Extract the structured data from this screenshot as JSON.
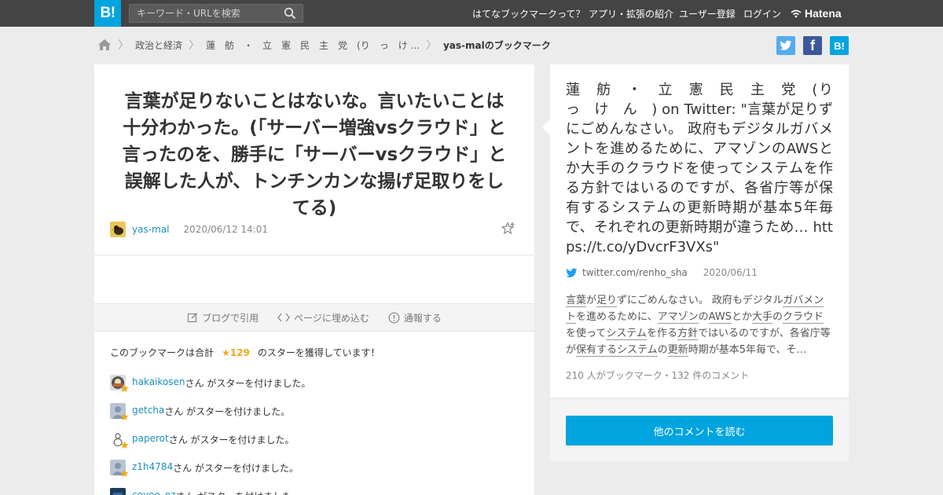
{
  "header": {
    "logo": "B!",
    "search_placeholder": "キーワード・URLを検索",
    "nav": [
      "はてなブックマークって？",
      "アプリ・拡張の紹介",
      "ユーザー登録",
      "ログイン"
    ],
    "hatena": "Hatena"
  },
  "breadcrumb": {
    "items": [
      "政治と経済",
      "蓮　舫　・　立　憲　民　主　党　(り　っ　け ..."
    ],
    "current": "yas-malのブックマーク"
  },
  "share": {
    "twitter": "twitter",
    "facebook": "f",
    "hatena": "B!"
  },
  "bookmark": {
    "comment": "言葉が足りないことはないな。言いたいことは十分わかった。(「サーバー増強vsクラウド」と言ったのを、勝手に「サーバーvsクラウド」と誤解した人が、トンチンカンな揚げ足取りをしてる)",
    "user": "yas-mal",
    "date": "2020/06/12 14:01"
  },
  "actions": {
    "blog": "ブログで引用",
    "embed": "ページに埋め込む",
    "report": "通報する"
  },
  "stars": {
    "prefix": "このブックマークは合計",
    "count": "★129",
    "suffix": "のスターを獲得しています！",
    "starer_suffix": "さん がスターを付けました。",
    "starers": [
      "hakaikosen",
      "getcha",
      "paperot",
      "z1h4784",
      "coyoo_oz"
    ]
  },
  "entry": {
    "title": "蓮　舫　・　立　憲　民　主　党　(り　っ　け　ん　) on Twitter: \"言葉が足りずにごめんなさい。 政府もデジタルガバメントを進めるために、アマゾンのAWSとか大手のクラウドを使ってシステムを作る方針ではいるのですが、各省庁等が保有するシステムの更新時期が基本5年毎で、それぞれの更新時期が違うため… https://t.co/yDvcrF3VXs\"",
    "domain": "twitter.com/renho_sha",
    "date": "2020/06/11",
    "summary_parts": [
      {
        "t": "言葉",
        "k": true
      },
      {
        "t": "が",
        "k": false
      },
      {
        "t": "足り",
        "k": true
      },
      {
        "t": "ずにごめんなさい。 政府もデジタル",
        "k": false
      },
      {
        "t": "ガバメント",
        "k": true
      },
      {
        "t": "を進めるために、",
        "k": false
      },
      {
        "t": "アマゾン",
        "k": true
      },
      {
        "t": "の",
        "k": false
      },
      {
        "t": "AWS",
        "k": true
      },
      {
        "t": "とか",
        "k": false
      },
      {
        "t": "大手",
        "k": true
      },
      {
        "t": "の",
        "k": false
      },
      {
        "t": "クラウド",
        "k": true
      },
      {
        "t": "を使って",
        "k": false
      },
      {
        "t": "システム",
        "k": true
      },
      {
        "t": "を作る",
        "k": false
      },
      {
        "t": "方針",
        "k": true
      },
      {
        "t": "ではいるのですが、各省庁等が",
        "k": false
      },
      {
        "t": "保有する",
        "k": true
      },
      {
        "t": "システム",
        "k": true
      },
      {
        "t": "の",
        "k": false
      },
      {
        "t": "更新",
        "k": true
      },
      {
        "t": "時期が基本5年毎で、そ…",
        "k": false
      }
    ],
    "stats": "210 人がブックマーク・132 件のコメント",
    "more_button": "他のコメントを読む"
  },
  "colors": {
    "accent": "#00a4de",
    "header": "#444444",
    "star": "#f0a818",
    "link": "#1a8fbf"
  }
}
